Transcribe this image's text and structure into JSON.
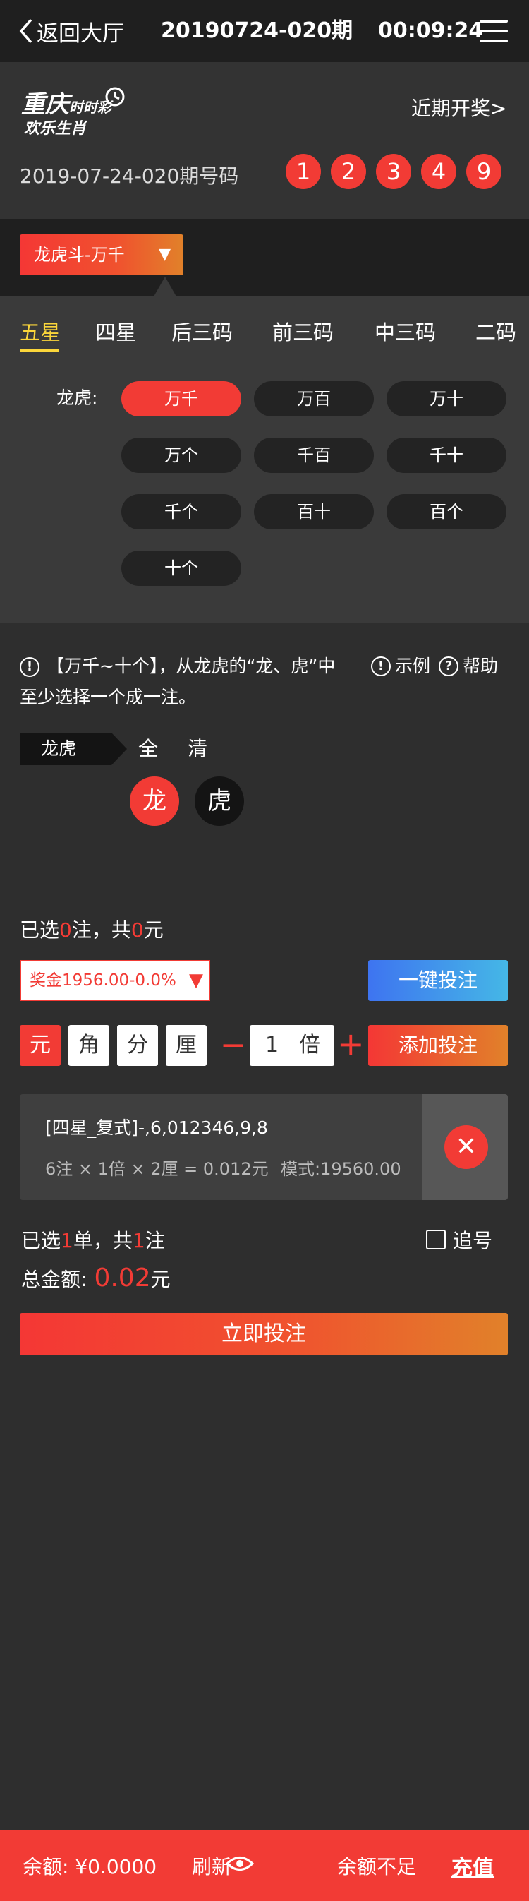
{
  "topbar": {
    "back_label": "返回大厅",
    "period": "20190724-020期",
    "timer": "00:09:24"
  },
  "header": {
    "logo_line1": "重庆",
    "logo_line1b": "时时彩",
    "logo_line2": "欢乐生肖",
    "recent_link": "近期开奖>",
    "draw_label": "2019-07-24-020期号码",
    "balls": [
      "1",
      "2",
      "3",
      "4",
      "9"
    ]
  },
  "play": {
    "selected": "龙虎斗-万千",
    "arrow": "▼"
  },
  "tabs": [
    "五星",
    "四星",
    "后三码",
    "前三码",
    "中三码",
    "二码"
  ],
  "positions": {
    "label": "龙虎:",
    "options": [
      "万千",
      "万百",
      "万十",
      "万个",
      "千百",
      "千十",
      "千个",
      "百十",
      "百个",
      "十个"
    ]
  },
  "tip": {
    "icon": "!",
    "text": "【万千~十个】，从龙虎的“龙、虎”中至少选择一个成一注。",
    "example": "示例",
    "help": "帮助"
  },
  "picker": {
    "group": "龙虎",
    "all": "全",
    "clear": "清",
    "dragon": "龙",
    "tiger": "虎"
  },
  "selection": {
    "prefix": "已选",
    "count": "0",
    "mid": "注，共",
    "amount": "0",
    "suffix": "元"
  },
  "prize": {
    "value": "奖金1956.00-0.0%",
    "arrow": "▼"
  },
  "one_key_bet": "一键投注",
  "units": [
    "元",
    "角",
    "分",
    "厘"
  ],
  "multiplier": {
    "minus": "−",
    "value": "1",
    "unit": "倍",
    "plus": "+"
  },
  "add_bet": "添加投注",
  "bet_item": {
    "line1": "[四星_复式]-,6,012346,9,8",
    "line2": "6注 × 1倍 × 2厘 = 0.012元",
    "mode": "模式:19560.00",
    "delete": "✕"
  },
  "order": {
    "prefix": "已选",
    "orders": "1",
    "mid": "单，共",
    "bets": "1",
    "suffix": "注"
  },
  "chase": "追号",
  "total": {
    "label": "总金额:",
    "amount": "0.02",
    "unit": "元"
  },
  "bet_now": "立即投注",
  "footer": {
    "balance": "余额: ¥0.0000",
    "refresh": "刷新",
    "insufficient": "余额不足",
    "recharge": "充值"
  },
  "colors": {
    "accent_red": "#f23b35",
    "accent_orange": "#e1812a",
    "tab_active": "#fbd63a",
    "blue": "#3e74f0"
  }
}
